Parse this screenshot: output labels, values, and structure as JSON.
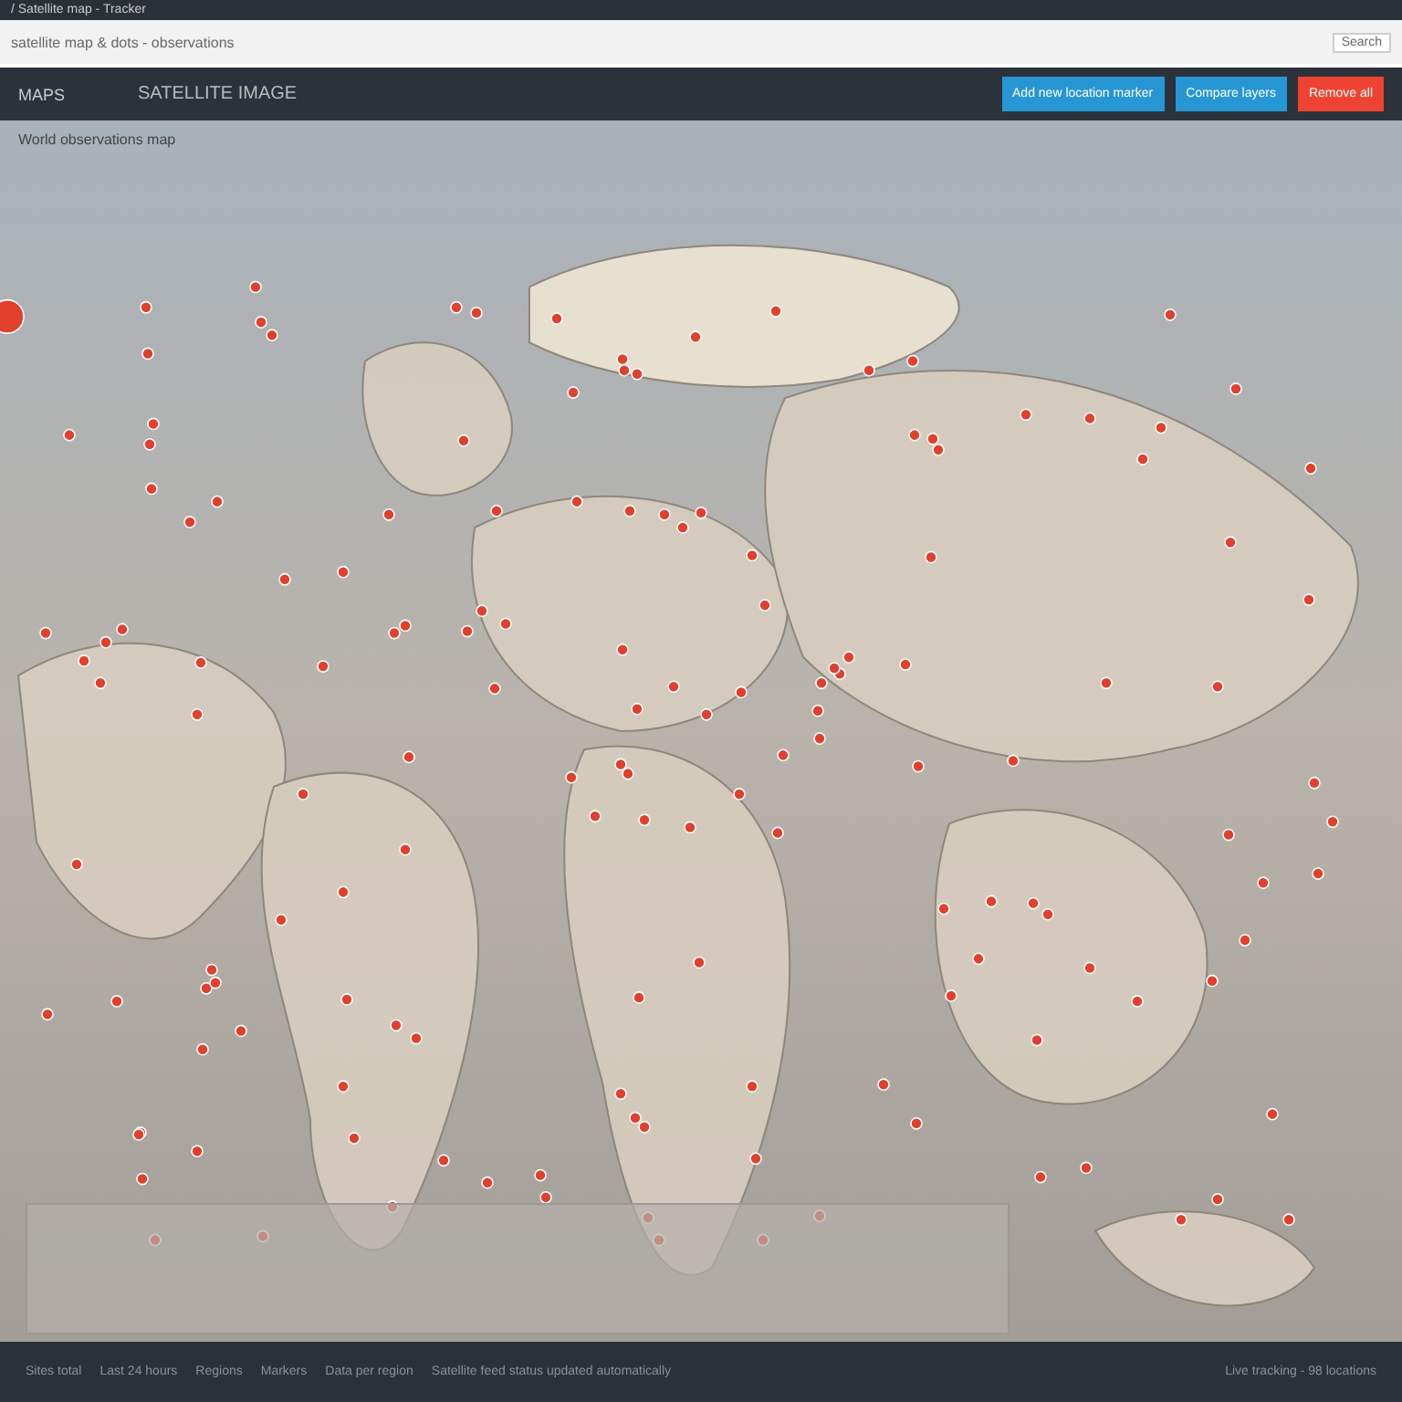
{
  "browser": {
    "tab_title": "/ Satellite map - Tracker",
    "address": "satellite map & dots - observations",
    "address_button": "Search"
  },
  "header": {
    "logo": "MAPS",
    "title": "SATELLITE IMAGE",
    "buttons": [
      {
        "label": "Add new location marker",
        "kind": "primary"
      },
      {
        "label": "Compare layers",
        "kind": "primary"
      },
      {
        "label": "Remove all",
        "kind": "danger"
      }
    ]
  },
  "map": {
    "caption": "World observations map"
  },
  "footer": {
    "items": [
      "Sites total",
      "Last 24 hours",
      "Regions",
      "Markers",
      "Data per region",
      "Satellite feed status updated automatically"
    ],
    "right": "Live tracking - 98 locations"
  }
}
